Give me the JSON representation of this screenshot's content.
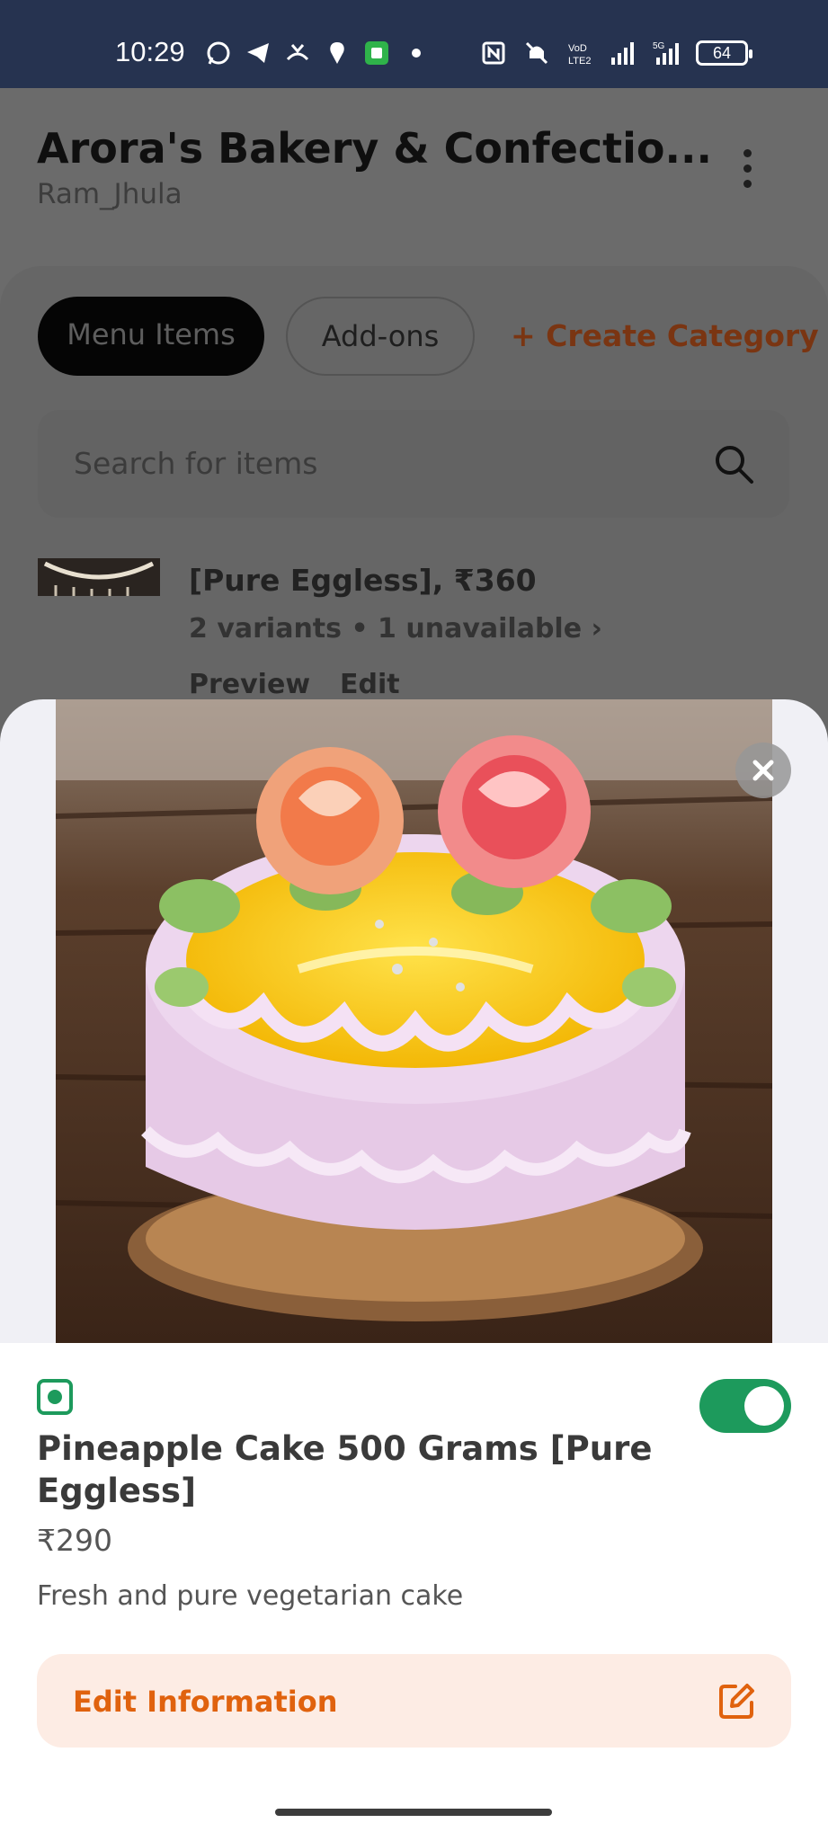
{
  "status_bar": {
    "time": "10:29",
    "battery": "64",
    "network_label": "5G"
  },
  "background_page": {
    "store_title": "Arora's Bakery & Confectio...",
    "store_subtitle": "Ram_Jhula",
    "tabs": [
      {
        "label": "Menu Items",
        "active": true
      },
      {
        "label": "Add-ons",
        "active": false
      }
    ],
    "create_category_label": "+ Create Category",
    "search": {
      "placeholder": "Search for items"
    },
    "item": {
      "title": "[Pure Eggless], ₹360",
      "variants": "2 variants • 1 unavailable",
      "preview_label": "Preview",
      "edit_label": "Edit"
    }
  },
  "sheet": {
    "image_subject": "pineapple-cake-photo",
    "name": "Pineapple Cake 500 Grams [Pure Eggless]",
    "price": "₹290",
    "description": "Fresh and pure vegetarian cake",
    "available": true,
    "veg": true,
    "edit_button_label": "Edit Information"
  },
  "colors": {
    "accent_orange": "#e0620e",
    "veg_green": "#1d9a5c",
    "status_bar_bg": "#263350"
  }
}
